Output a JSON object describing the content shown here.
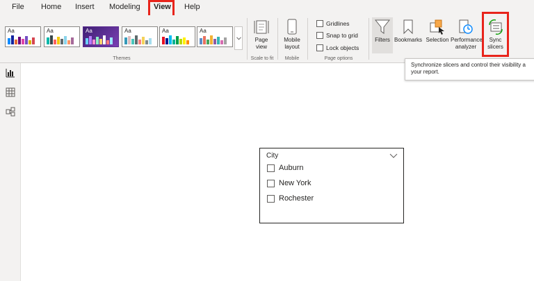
{
  "menu": {
    "items": [
      "File",
      "Home",
      "Insert",
      "Modeling",
      "View",
      "Help"
    ],
    "active": "View"
  },
  "ribbon": {
    "themes_label": "Themes",
    "theme_thumb_text": "Aa",
    "page_view_label": "Page view",
    "scale_group_label": "Scale to fit",
    "mobile_layout_label": "Mobile layout",
    "mobile_group_label": "Mobile",
    "gridlines_label": "Gridlines",
    "snap_label": "Snap to grid",
    "lock_label": "Lock objects",
    "page_options_label": "Page options",
    "filters_label": "Filters",
    "bookmarks_label": "Bookmarks",
    "selection_label": "Selection",
    "performance_label_1": "Performance",
    "performance_label_2": "analyzer",
    "sync_label_1": "Sync",
    "sync_label_2": "slicers"
  },
  "tooltip": {
    "line1": "Synchronize slicers and control their visibility a",
    "line2": "your report."
  },
  "slicer": {
    "title": "City",
    "items": [
      "Auburn",
      "New York",
      "Rochester"
    ]
  },
  "colors": {
    "highlight": "#e8241b",
    "ribbon_bg": "#f3f2f1",
    "accent_blue": "#118dff"
  }
}
